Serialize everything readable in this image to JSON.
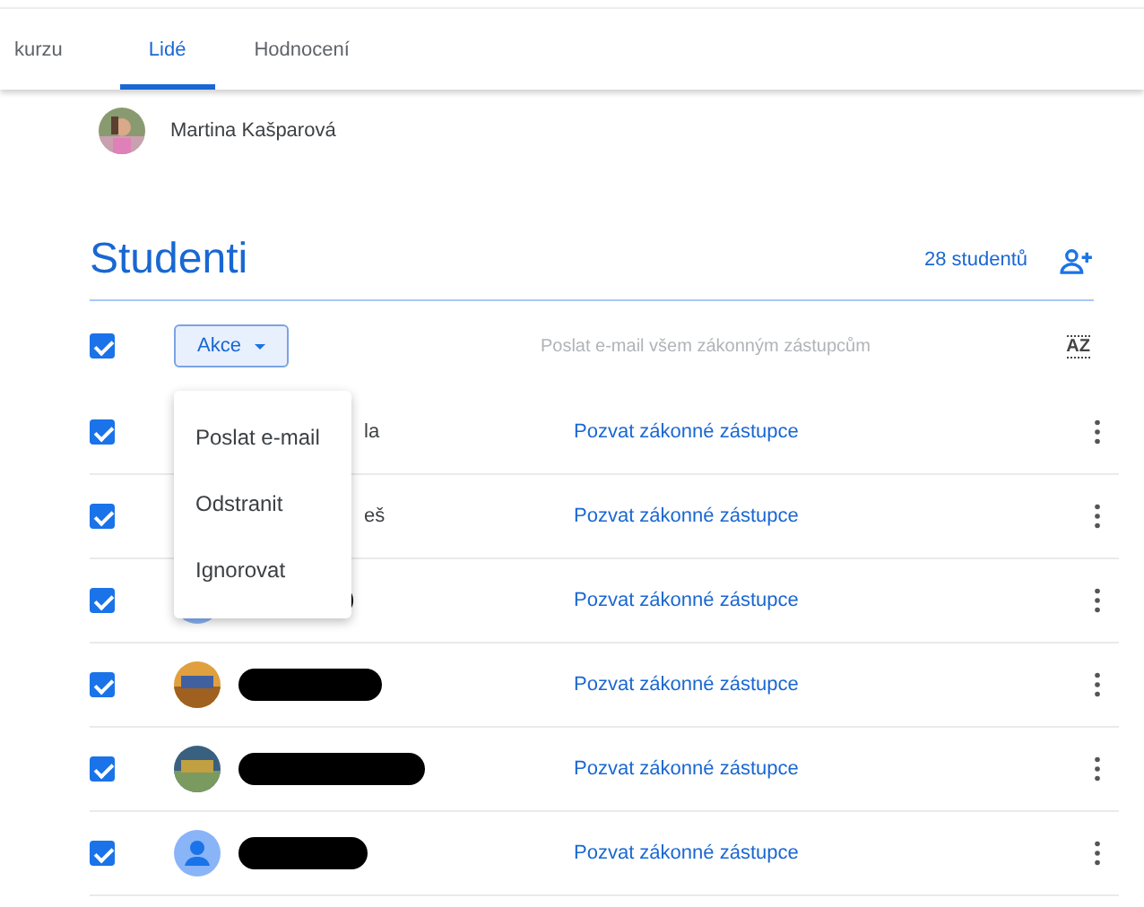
{
  "tabs": [
    {
      "label": "kurzu",
      "selected": false
    },
    {
      "label": "Lidé",
      "selected": true
    },
    {
      "label": "Hodnocení",
      "selected": false
    }
  ],
  "teacher": {
    "name": "Martina Kašparová"
  },
  "section": {
    "title": "Studenti",
    "count": "28 studentů"
  },
  "toolbar": {
    "checked": true,
    "actions_label": "Akce",
    "email_all": "Poslat e-mail všem zákonným zástupcům",
    "sort_label": "AZ"
  },
  "menu": {
    "items": [
      "Poslat e-mail",
      "Odstranit",
      "Ignorovat"
    ]
  },
  "students": [
    {
      "checked": true,
      "kind": "covered",
      "name": "la",
      "link": "Pozvat zákonné zástupce"
    },
    {
      "checked": true,
      "kind": "covered",
      "name": "eš",
      "link": "Pozvat zákonné zástupce"
    },
    {
      "checked": true,
      "kind": "default",
      "link": "Pozvat zákonné zástupce"
    },
    {
      "checked": true,
      "kind": "picture",
      "link": "Pozvat zákonné zástupce"
    },
    {
      "checked": true,
      "kind": "picture",
      "link": "Pozvat zákonné zástupce"
    },
    {
      "checked": true,
      "kind": "default",
      "link": "Pozvat zákonné zástupce"
    }
  ]
}
